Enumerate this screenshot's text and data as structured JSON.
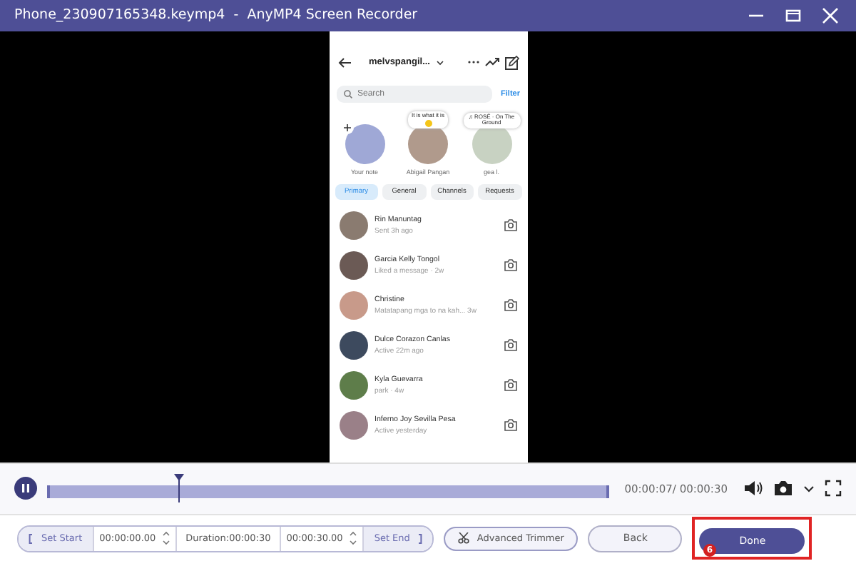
{
  "window": {
    "title": "Phone_230907165348.keymp4  -  AnyMP4 Screen Recorder"
  },
  "phone": {
    "username": "melvspangil...",
    "search": {
      "placeholder": "Search"
    },
    "filter": "Filter",
    "notes": [
      {
        "kind": "own",
        "name": "Your note"
      },
      {
        "kind": "text",
        "bubble": "It is what it is",
        "name": "Abigail Pangan"
      },
      {
        "kind": "music",
        "bubble": "♫ ROSÉ · On The Ground",
        "name": "gea l."
      }
    ],
    "tabs": [
      {
        "label": "Primary",
        "selected": true
      },
      {
        "label": "General",
        "selected": false
      },
      {
        "label": "Channels",
        "selected": false
      },
      {
        "label": "Requests",
        "selected": false
      }
    ],
    "messages": [
      {
        "name": "Rin Manuntag",
        "status": "Sent 3h ago"
      },
      {
        "name": "Garcia Kelly Tongol",
        "status": "Liked a message · 2w"
      },
      {
        "name": "Christine",
        "status": "Matatapang mga to na kah... 3w"
      },
      {
        "name": "Dulce Corazon Canlas",
        "status": "Active 22m ago"
      },
      {
        "name": "Kyla Guevarra",
        "status": "park · 4w"
      },
      {
        "name": "Inferno Joy Sevilla Pesa",
        "status": "Active yesterday"
      }
    ]
  },
  "player": {
    "level": 0.236,
    "time": "00:00:07/ 00:00:30"
  },
  "trim": {
    "set_start": "Set Start",
    "start": "00:00:00.00",
    "duration": "Duration:00:00:30",
    "end": "00:00:30.00",
    "set_end": "Set End",
    "advanced": "Advanced Trimmer"
  },
  "back": "Back",
  "done": "Done",
  "step": "6"
}
